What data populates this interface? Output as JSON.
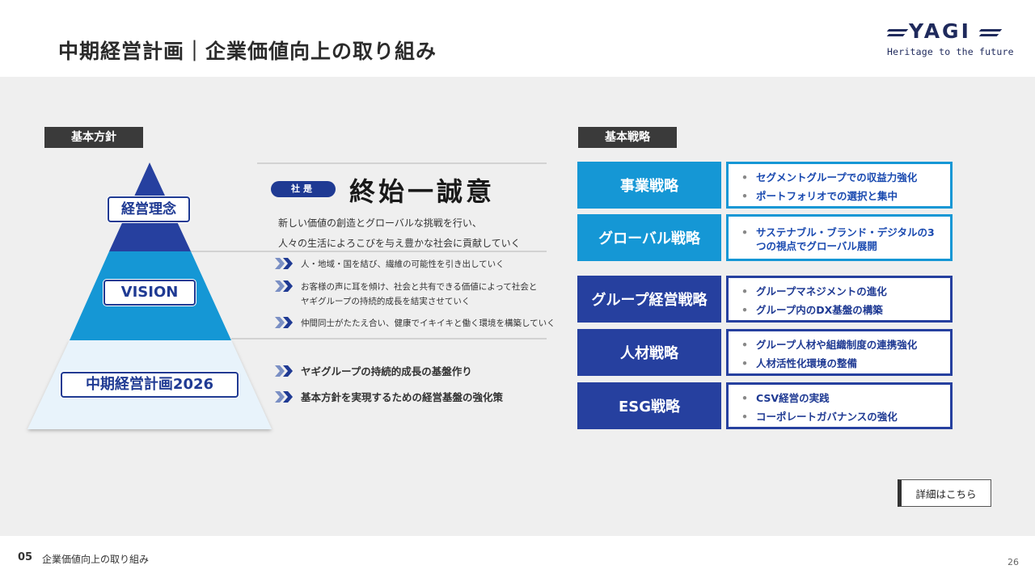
{
  "header": {
    "title": "中期経営計画｜企業価値向上の取り組み",
    "logo_word": "YAGI",
    "logo_tagline": "Heritage to the future"
  },
  "left": {
    "section_label": "基本方針",
    "pyramid": {
      "top_label": "経営理念",
      "middle_label": "VISION",
      "bottom_label": "中期経営計画2026",
      "colors": {
        "top": "#26409f",
        "middle": "#1597d5",
        "bottom": "#e8f3fb"
      }
    },
    "motto_badge": "社是",
    "motto": "終始一誠意",
    "philosophy_lines": [
      "新しい価値の創造とグローバルな挑戦を行い、",
      "人々の生活によろこびを与え豊かな社会に貢献していく"
    ],
    "vision_items": [
      "人・地域・国を結び、繊維の可能性を引き出していく",
      "お客様の声に耳を傾け、社会と共有できる価値によって社会と",
      "ヤギグループの持続的成長を結実させていく",
      "仲間同士がたたえ合い、健康でイキイキと働く環境を構築していく"
    ],
    "plan_items": [
      "ヤギグループの持続的成長の基盤作り",
      "基本方針を実現するための経営基盤の強化策"
    ]
  },
  "right": {
    "section_label": "基本戦略",
    "strategies": [
      {
        "name": "事業戦略",
        "bullets": [
          "セグメントグループでの収益力強化",
          "ポートフォリオでの選択と集中"
        ]
      },
      {
        "name": "グローバル戦略",
        "bullets": [
          "サステナブル・ブランド・デジタルの3つの視点でグローバル展開"
        ]
      },
      {
        "name": "グループ経営戦略",
        "bullets": [
          "グループマネジメントの進化",
          "グループ内のDX基盤の構築"
        ]
      },
      {
        "name": "人材戦略",
        "bullets": [
          "グループ人材や組織制度の連携強化",
          "人材活性化環境の整備"
        ]
      },
      {
        "name": "ESG戦略",
        "bullets": [
          "CSV経営の実践",
          "コーポレートガバナンスの強化"
        ]
      }
    ],
    "detail_button": "詳細はこちら"
  },
  "footer": {
    "section_number": "05",
    "section_title": "企業価値向上の取り組み",
    "page_number": "26"
  }
}
